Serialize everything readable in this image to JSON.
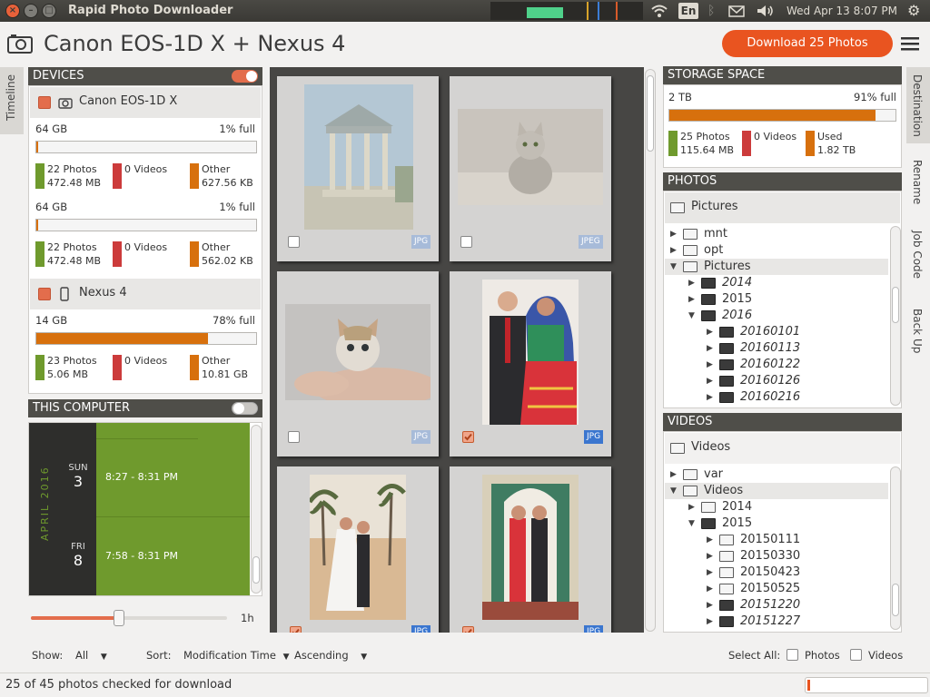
{
  "topbar": {
    "title": "Rapid Photo Downloader",
    "clock": "Wed Apr 13  8:07 PM",
    "keyboard_indicator": "En",
    "icons": [
      "network-icon",
      "keyboard-layout-icon",
      "bluetooth-icon",
      "mail-icon",
      "volume-icon",
      "settings-gear-icon"
    ]
  },
  "header": {
    "title": "Canon EOS-1D X + Nexus 4",
    "download_label": "Download 25 Photos"
  },
  "side_tabs": {
    "left": "Timeline",
    "right": [
      "Destination",
      "Rename",
      "Job Code",
      "Back Up"
    ]
  },
  "devices": {
    "title": "DEVICES",
    "items": [
      {
        "name": "Canon EOS-1D X",
        "icon": "camera-icon",
        "storage": [
          {
            "size": "64 GB",
            "full": "1% full",
            "fill": 0.01,
            "photos": "22 Photos",
            "photos_size": "472.48 MB",
            "videos": "0 Videos",
            "other": "Other",
            "other_size": "627.56 KB"
          },
          {
            "size": "64 GB",
            "full": "1% full",
            "fill": 0.01,
            "photos": "22 Photos",
            "photos_size": "472.48 MB",
            "videos": "0 Videos",
            "other": "Other",
            "other_size": "562.02 KB"
          }
        ]
      },
      {
        "name": "Nexus 4",
        "icon": "phone-icon",
        "storage": [
          {
            "size": "14 GB",
            "full": "78% full",
            "fill": 0.78,
            "photos": "23 Photos",
            "photos_size": "5.06 MB",
            "videos": "0 Videos",
            "other": "Other",
            "other_size": "10.81 GB"
          }
        ]
      }
    ]
  },
  "this_computer": {
    "title": "THIS COMPUTER"
  },
  "timeline": {
    "month": "APRIL  2016",
    "entries": [
      {
        "dow": "SUN",
        "day": "3",
        "range": "8:27 - 8:31 PM"
      },
      {
        "dow": "FRI",
        "day": "8",
        "range": "7:58 - 8:31 PM"
      }
    ],
    "slider_label": "1h",
    "slider_value": 0.45
  },
  "thumbnails": [
    {
      "type": "JPG",
      "checked": false,
      "dim": true
    },
    {
      "type": "JPEG",
      "checked": false,
      "dim": true
    },
    {
      "type": "JPG",
      "checked": false,
      "dim": true
    },
    {
      "type": "JPG",
      "checked": true,
      "dim": false
    },
    {
      "type": "JPG",
      "checked": true,
      "dim": false
    },
    {
      "type": "JPG",
      "checked": true,
      "dim": false
    }
  ],
  "storage_space": {
    "title": "STORAGE SPACE",
    "size": "2 TB",
    "full": "91% full",
    "fill": 0.91,
    "photos": "25 Photos",
    "photos_size": "115.64 MB",
    "videos": "0 Videos",
    "used": "Used",
    "used_size": "1.82 TB"
  },
  "photos_panel": {
    "title": "PHOTOS",
    "destination": "Pictures",
    "tree": [
      {
        "label": "mnt",
        "level": 0,
        "arrow": "right",
        "dark": false,
        "italic": false
      },
      {
        "label": "opt",
        "level": 0,
        "arrow": "right",
        "dark": false,
        "italic": false
      },
      {
        "label": "Pictures",
        "level": 0,
        "arrow": "down",
        "dark": false,
        "italic": false,
        "selected": true
      },
      {
        "label": "2014",
        "level": 1,
        "arrow": "right",
        "dark": true,
        "italic": true
      },
      {
        "label": "2015",
        "level": 1,
        "arrow": "right",
        "dark": true,
        "italic": false
      },
      {
        "label": "2016",
        "level": 1,
        "arrow": "down",
        "dark": true,
        "italic": true
      },
      {
        "label": "20160101",
        "level": 2,
        "arrow": "right",
        "dark": true,
        "italic": true
      },
      {
        "label": "20160113",
        "level": 2,
        "arrow": "right",
        "dark": true,
        "italic": true
      },
      {
        "label": "20160122",
        "level": 2,
        "arrow": "right",
        "dark": true,
        "italic": true
      },
      {
        "label": "20160126",
        "level": 2,
        "arrow": "right",
        "dark": true,
        "italic": true
      },
      {
        "label": "20160216",
        "level": 2,
        "arrow": "right",
        "dark": true,
        "italic": true
      }
    ]
  },
  "videos_panel": {
    "title": "VIDEOS",
    "destination": "Videos",
    "tree": [
      {
        "label": "var",
        "level": 0,
        "arrow": "right",
        "dark": false,
        "italic": false
      },
      {
        "label": "Videos",
        "level": 0,
        "arrow": "down",
        "dark": false,
        "italic": false,
        "selected": true
      },
      {
        "label": "2014",
        "level": 1,
        "arrow": "right",
        "dark": false,
        "italic": false
      },
      {
        "label": "2015",
        "level": 1,
        "arrow": "down",
        "dark": true,
        "italic": false
      },
      {
        "label": "20150111",
        "level": 2,
        "arrow": "right",
        "dark": false,
        "italic": false
      },
      {
        "label": "20150330",
        "level": 2,
        "arrow": "right",
        "dark": false,
        "italic": false
      },
      {
        "label": "20150423",
        "level": 2,
        "arrow": "right",
        "dark": false,
        "italic": false
      },
      {
        "label": "20150525",
        "level": 2,
        "arrow": "right",
        "dark": false,
        "italic": false
      },
      {
        "label": "20151220",
        "level": 2,
        "arrow": "right",
        "dark": true,
        "italic": true
      },
      {
        "label": "20151227",
        "level": 2,
        "arrow": "right",
        "dark": true,
        "italic": true
      }
    ]
  },
  "bottom": {
    "show_label": "Show:",
    "show_value": "All",
    "sort_label": "Sort:",
    "sort_value": "Modification Time",
    "order_value": "Ascending",
    "select_all_label": "Select All:",
    "photos_label": "Photos",
    "videos_label": "Videos"
  },
  "status": {
    "text": "25 of 45 photos checked for download"
  },
  "colors": {
    "accent": "#e95420",
    "photo": "#6f9a2d",
    "video": "#cc3b3b",
    "other": "#d7700d",
    "timeline": "#6f9a2d"
  }
}
